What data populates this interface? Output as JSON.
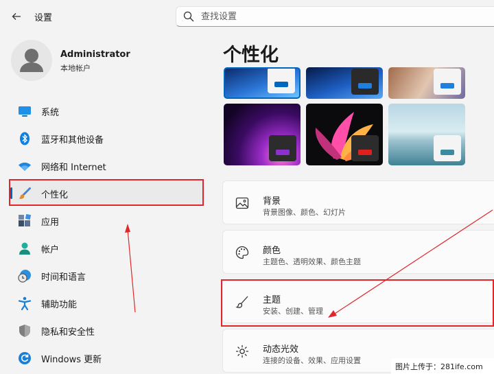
{
  "titlebar": {
    "app_title": "设置"
  },
  "search": {
    "placeholder": "查找设置"
  },
  "profile": {
    "name": "Administrator",
    "account_type": "本地帐户"
  },
  "sidebar": {
    "items": [
      {
        "label": "系统",
        "icon": "monitor-icon"
      },
      {
        "label": "蓝牙和其他设备",
        "icon": "bluetooth-icon"
      },
      {
        "label": "网络和 Internet",
        "icon": "wifi-icon"
      },
      {
        "label": "个性化",
        "icon": "brush-icon",
        "active": true
      },
      {
        "label": "应用",
        "icon": "apps-icon"
      },
      {
        "label": "帐户",
        "icon": "user-icon"
      },
      {
        "label": "时间和语言",
        "icon": "clock-globe-icon"
      },
      {
        "label": "辅助功能",
        "icon": "accessibility-icon"
      },
      {
        "label": "隐私和安全性",
        "icon": "shield-icon"
      },
      {
        "label": "Windows 更新",
        "icon": "refresh-icon"
      }
    ]
  },
  "main": {
    "title": "个性化",
    "settings": [
      {
        "title": "背景",
        "subtitle": "背景图像、颜色、幻灯片",
        "icon": "image-icon"
      },
      {
        "title": "颜色",
        "subtitle": "主题色、透明效果、颜色主题",
        "icon": "palette-icon"
      },
      {
        "title": "主题",
        "subtitle": "安装、创建、管理",
        "icon": "brush-icon"
      },
      {
        "title": "动态光效",
        "subtitle": "连接的设备、效果、应用设置",
        "icon": "light-effect-icon"
      }
    ]
  },
  "colors": {
    "accent": "#0067c0",
    "annotation_red": "#e0262a"
  },
  "watermark": {
    "text": "图片上传于：281ife.com"
  }
}
